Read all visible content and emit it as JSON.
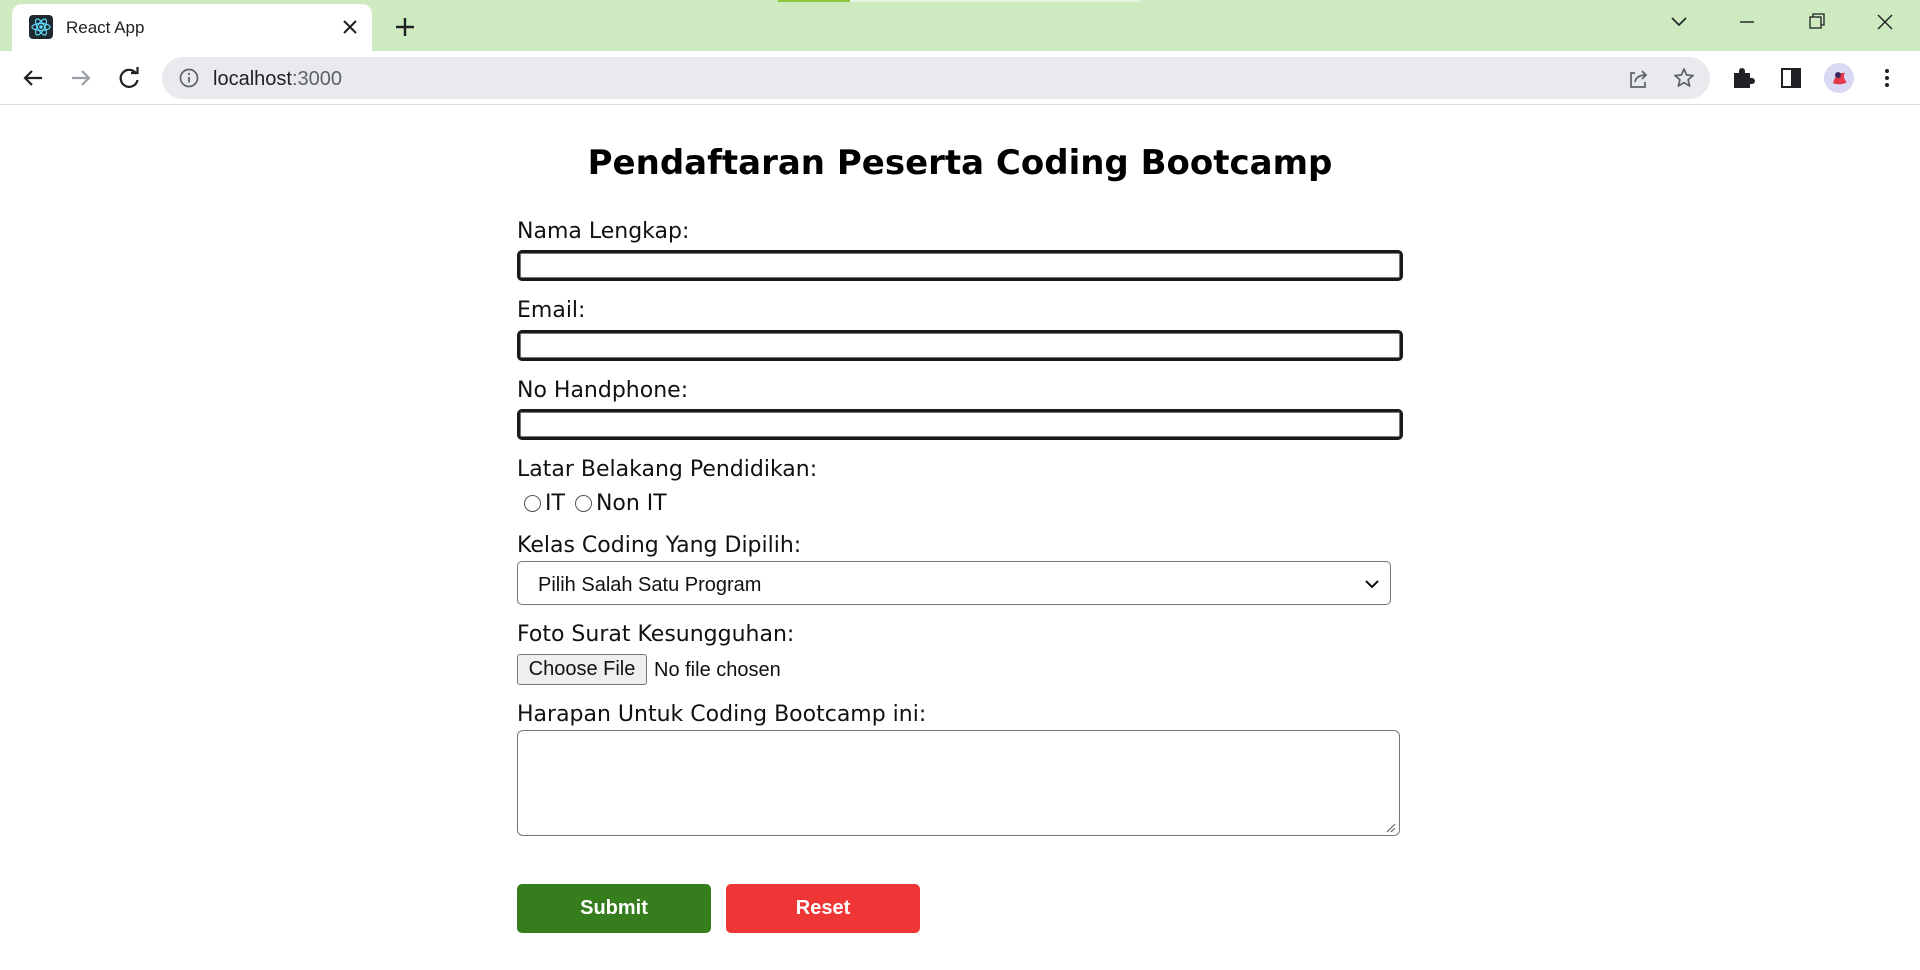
{
  "browser": {
    "tab_title": "React App",
    "url_host": "localhost",
    "url_port": ":3000"
  },
  "form": {
    "title": "Pendaftaran Peserta Coding Bootcamp",
    "nama_label": "Nama Lengkap:",
    "nama_value": "",
    "email_label": "Email:",
    "email_value": "",
    "phone_label": "No Handphone:",
    "phone_value": "",
    "background_label": "Latar Belakang Pendidikan:",
    "background_options": [
      "IT",
      "Non IT"
    ],
    "kelas_label": "Kelas Coding Yang Dipilih:",
    "kelas_selected": "Pilih Salah Satu Program",
    "foto_label": "Foto Surat Kesungguhan:",
    "file_button": "Choose File",
    "file_status": "No file chosen",
    "harapan_label": "Harapan Untuk Coding Bootcamp ini:",
    "harapan_value": "",
    "submit_label": "Submit",
    "reset_label": "Reset"
  },
  "colors": {
    "tabbar_bg": "#cdeac0",
    "submit_bg": "#367d1e",
    "reset_bg": "#ee3636"
  }
}
